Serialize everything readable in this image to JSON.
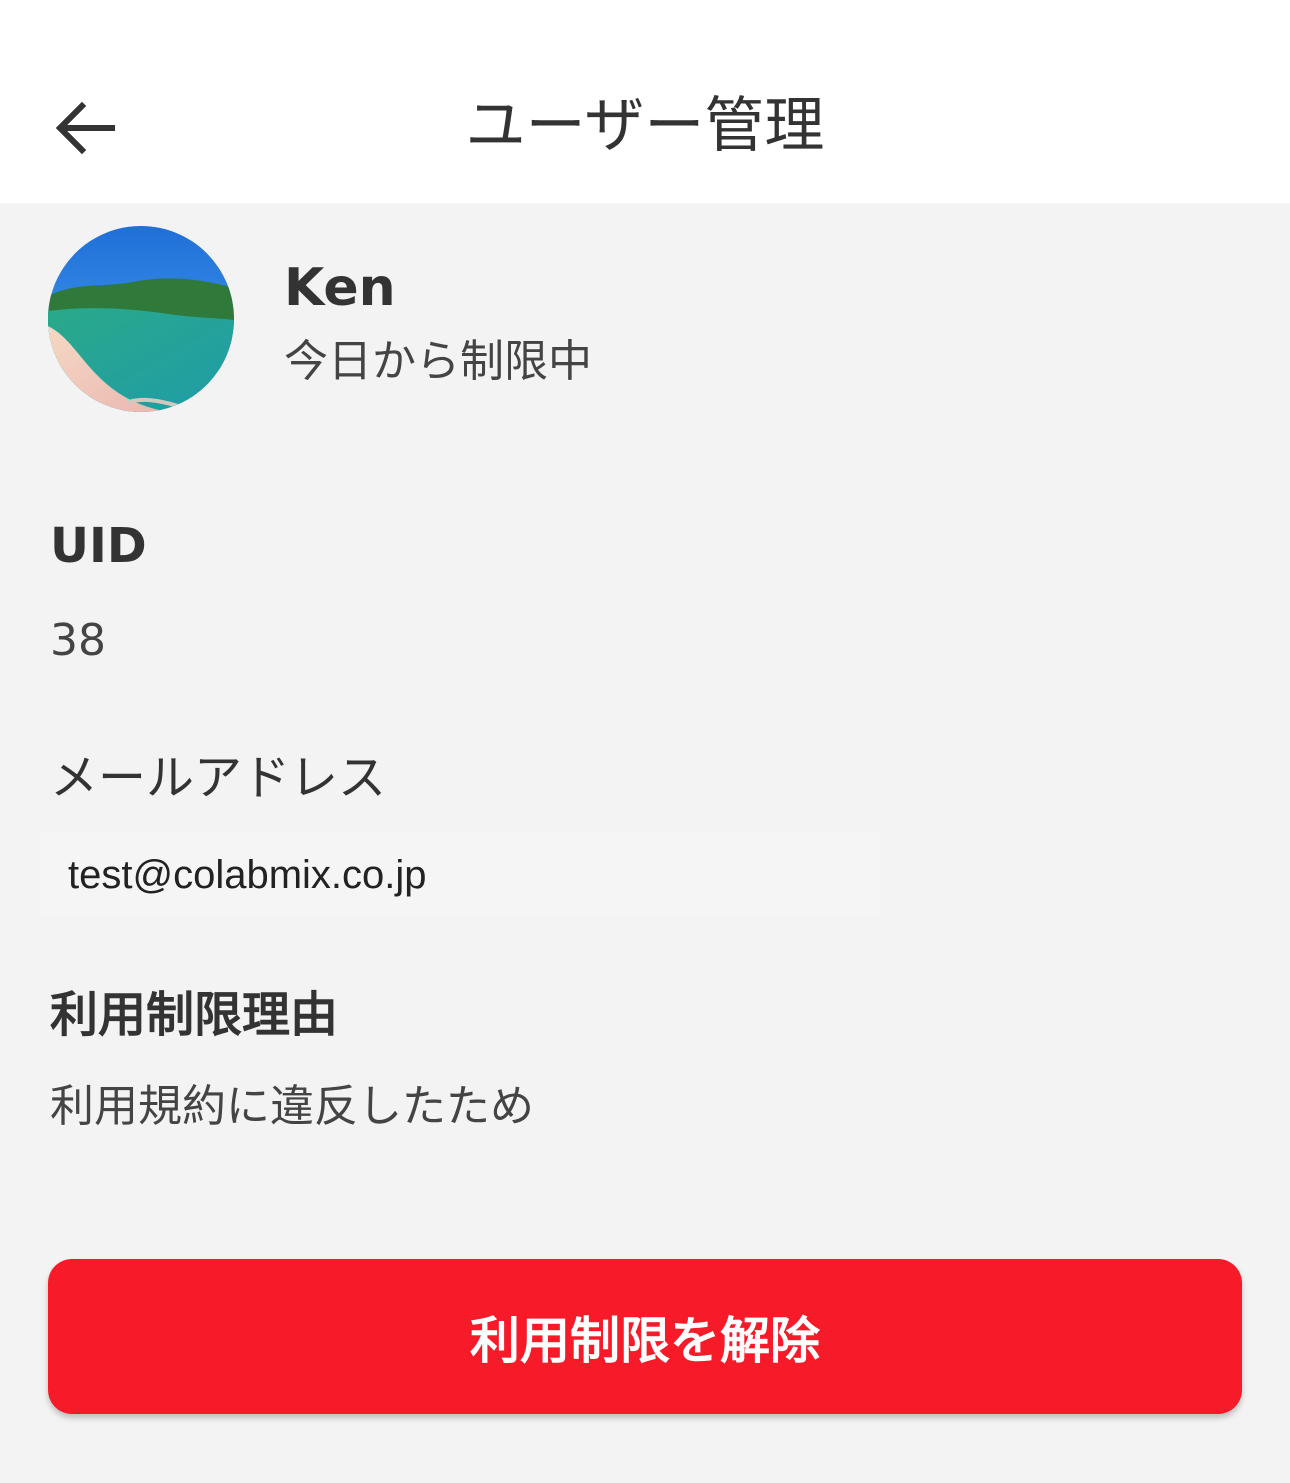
{
  "header": {
    "title": "ユーザー管理",
    "back_icon": "arrow-left-icon"
  },
  "user": {
    "name": "Ken",
    "status": "今日から制限中",
    "avatar_icon": "beach-avatar-image"
  },
  "fields": {
    "uid_label": "UID",
    "uid_value": "38",
    "email_label": "メールアドレス",
    "email_value": "test@colabmix.co.jp",
    "reason_label": "利用制限理由",
    "reason_value": "利用規約に違反したため"
  },
  "actions": {
    "release_label": "利用制限を解除"
  },
  "colors": {
    "accent": "#f71a28",
    "background": "#f3f3f3",
    "header": "#ffffff"
  }
}
